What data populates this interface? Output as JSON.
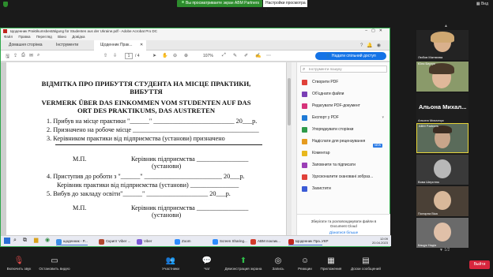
{
  "zoom_top": {
    "share_status": "Вы просматриваете экран ABM Partners",
    "view_options": "Настройки просмотра",
    "gallery": "Вид"
  },
  "acrobat": {
    "window_title": "Щоденник Praktikumsbestätigung für Studenten aus der Ukraine.pdf - Adobe Acrobat Pro DC",
    "menu": [
      "Файл",
      "Правка",
      "Перегляд",
      "Вікно",
      "Довідка"
    ],
    "tabs": {
      "home": "Домашня сторінка",
      "tools": "Інструменти",
      "doc": "Щоденник Прак..."
    },
    "toolbar": {
      "page_current": "1",
      "page_total": "/ 4",
      "zoom": "107%",
      "share_button": "Надати спільний доступ"
    },
    "document": {
      "title_ua_1": "ВІДМІТКА ПРО ПРИБУТТЯ СТУДЕНТА НА МІСЦЕ ПРАКТИКИ,",
      "title_ua_2": "ВИБУТТЯ",
      "title_de_1": "VERMERK ÜBER DAS EINKOMMEN VOM STUDENTEN AUF DAS",
      "title_de_2": "ORT DES PRAKTIKUMS, DAS AUSTRETEN",
      "item1": "1.   Прибув на місце практики \"______\" _________________________ 20___р.",
      "item2": "2.   Призначено на робоче місце _______________________________________",
      "item3": "3.   Керівником практики від підприємства (установи) призначено",
      "mp_1": "М.П.",
      "signer_1": "Керівник підприємства ________________",
      "inst_1": "(установи)",
      "item4": "4.   Приступив до роботи з  \"______\" ________________________ 20___р.",
      "item4b": "Керівник практики від підприємства (установи) _______________",
      "item5": "5.   Вибув до закладу освіти\"______\" ___________________ 20___р.",
      "mp_2": "М.П.",
      "signer_2": "Керівник підприємства ________________",
      "inst_2": "(установи)"
    },
    "tools_panel": {
      "search_placeholder": "Інструменти пошуку",
      "items": [
        {
          "label": "Створити PDF",
          "color": "#e0413a"
        },
        {
          "label": "Об'єднати файли",
          "color": "#7b3fb6"
        },
        {
          "label": "Редагувати PDF-документ",
          "color": "#d6347a"
        },
        {
          "label": "Експорт у PDF",
          "color": "#1f7ad6"
        },
        {
          "label": "Упорядкувати сторінки",
          "color": "#2e9a4a"
        },
        {
          "label": "Надіслати для рецензування",
          "color": "#e59b1f"
        },
        {
          "label": "Коментар",
          "color": "#e8b81e"
        },
        {
          "label": "Заповнити та підписати",
          "color": "#9b3fb6"
        },
        {
          "label": "Удосконалити скановані зобраз...",
          "color": "#e0413a"
        },
        {
          "label": "Захистити",
          "color": "#3b5bd6"
        }
      ],
      "new_badge": "NEW",
      "footer_line1": "Зберігати та розповсюджувати файли в",
      "footer_line2": "Document Cloud",
      "footer_link": "Дізнатися більше"
    }
  },
  "taskbar": {
    "items": [
      {
        "label": "щоденник - P...",
        "color": "#3a8ee6"
      },
      {
        "label": "Скрипт Viber ...",
        "color": "#b1462e"
      },
      {
        "label": "Viber",
        "color": "#7b5ad6"
      },
      {
        "label": "Zoom",
        "color": "#2d8cff"
      },
      {
        "label": "Screen Sharing...",
        "color": "#2d8cff"
      },
      {
        "label": "ABM поклик...",
        "color": "#d33b2a"
      },
      {
        "label": "Щоденник Пра...",
        "color": "#c0261e"
      }
    ],
    "lang": "УКР",
    "time": "12:09",
    "date": "20.04.2023"
  },
  "participants": [
    {
      "name": "Любов Матвєєва"
    },
    {
      "name": "Юля Бергук"
    },
    {
      "name": "Альона Михалчук",
      "big_name": "Альона  Михал..."
    },
    {
      "name": "ABM Partners"
    },
    {
      "name": "Вова Шерстюк"
    },
    {
      "name": "Полярна Віка"
    },
    {
      "name": "Кащук Надія"
    }
  ],
  "page_indicator": "1/2",
  "controls": {
    "unmute": "Включить звук",
    "video": "Остановить видео",
    "participants": "Участники",
    "participants_count": "30",
    "chat": "Чат",
    "share": "Демонстрация экрана",
    "record": "Запись",
    "reactions": "Реакции",
    "apps": "Приложения",
    "whiteboards": "Доски сообщений",
    "leave": "Выйти"
  }
}
